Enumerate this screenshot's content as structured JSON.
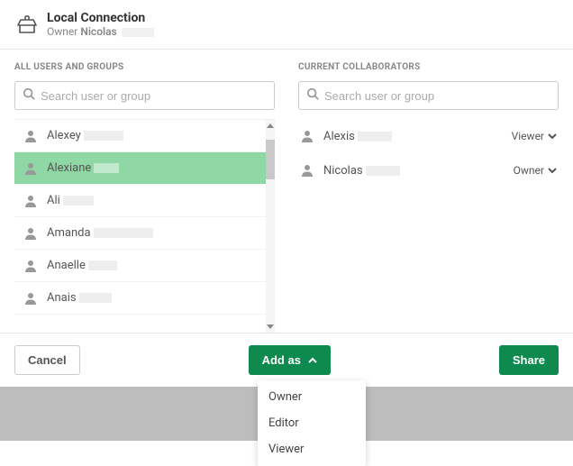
{
  "header": {
    "title": "Local Connection",
    "owner_label": "Owner",
    "owner_name": "Nicolas"
  },
  "left": {
    "section_label": "ALL USERS AND GROUPS",
    "search_placeholder": "Search user or group",
    "users": [
      {
        "name": "Alexey",
        "redact_w": 44,
        "selected": false
      },
      {
        "name": "Alexiane",
        "redact_w": 28,
        "selected": true
      },
      {
        "name": "Ali",
        "redact_w": 34,
        "selected": false
      },
      {
        "name": "Amanda",
        "redact_w": 66,
        "selected": false
      },
      {
        "name": "Anaelle",
        "redact_w": 32,
        "selected": false
      },
      {
        "name": "Anais",
        "redact_w": 36,
        "selected": false
      }
    ]
  },
  "right": {
    "section_label": "CURRENT COLLABORATORS",
    "search_placeholder": "Search user or group",
    "collaborators": [
      {
        "name": "Alexis",
        "redact_w": 38,
        "role": "Viewer"
      },
      {
        "name": "Nicolas",
        "redact_w": 38,
        "role": "Owner"
      }
    ]
  },
  "footer": {
    "cancel": "Cancel",
    "add_as": "Add as",
    "share": "Share",
    "menu": [
      "Owner",
      "Editor",
      "Viewer"
    ]
  },
  "colors": {
    "accent": "#0f8a4f",
    "selection": "#8fd8a5"
  }
}
